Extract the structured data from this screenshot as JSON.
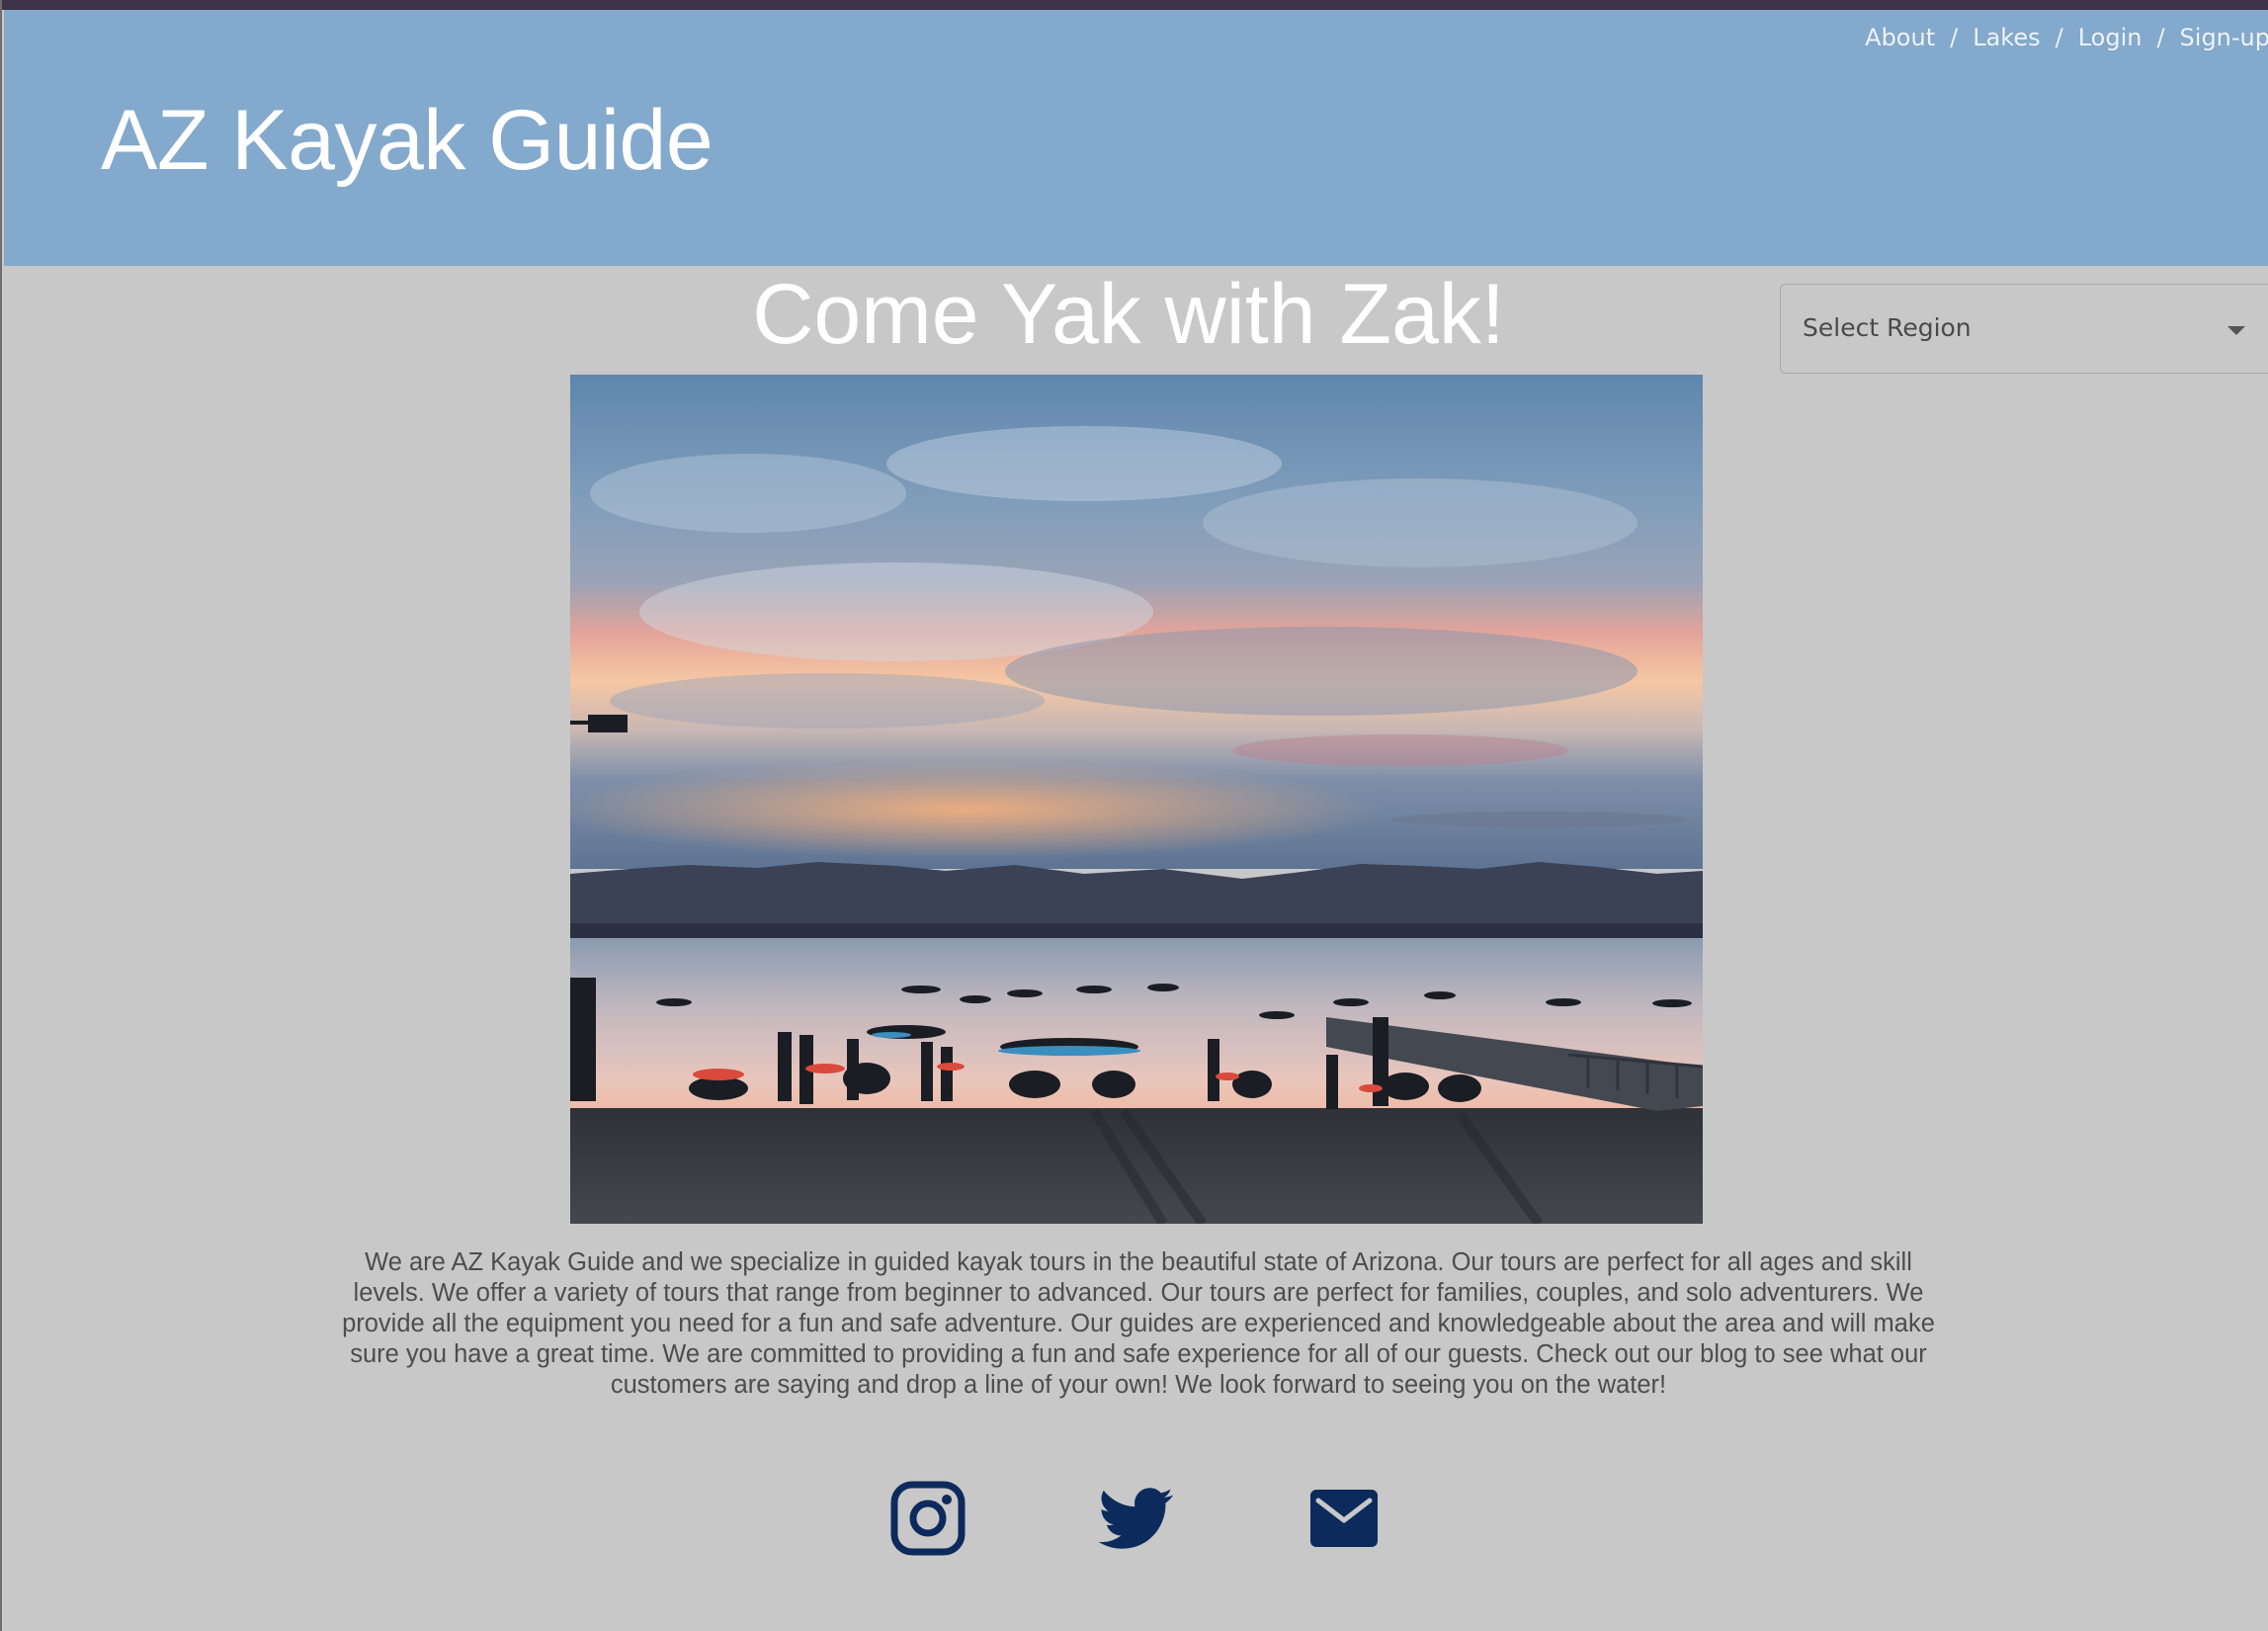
{
  "header": {
    "site_title": "AZ Kayak Guide",
    "nav": [
      {
        "label": "About"
      },
      {
        "label": "Lakes"
      },
      {
        "label": "Login"
      },
      {
        "label": "Sign-up"
      }
    ],
    "nav_separator": "/"
  },
  "main": {
    "hero_title": "Come Yak with Zak!",
    "region_select": {
      "selected_label": "Select Region"
    },
    "description": "We are AZ Kayak Guide and we specialize in guided kayak tours in the beautiful state of Arizona. Our tours are perfect for all ages and skill levels. We offer a variety of tours that range from beginner to advanced. Our tours are perfect for families, couples, and solo adventurers. We provide all the equipment you need for a fun and safe adventure. Our guides are experienced and knowledgeable about the area and will make sure you have a great time. We are committed to providing a fun and safe experience for all of our guests. Check out our blog to see what our customers are saying and drop a line of your own! We look forward to seeing you on the water!"
  },
  "social_links": [
    {
      "icon": "instagram-icon"
    },
    {
      "icon": "twitter-icon"
    },
    {
      "icon": "email-icon"
    }
  ],
  "colors": {
    "header_bg": "#83a9cc",
    "page_bg": "#c8c8c8",
    "icon_color": "#0d2a5c",
    "top_strip": "#3d3248"
  }
}
